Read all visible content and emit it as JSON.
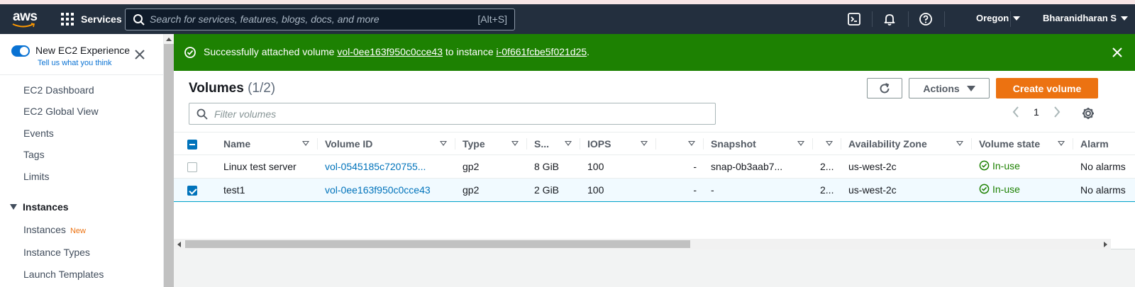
{
  "topbar": {
    "logo_text": "aws",
    "services_label": "Services",
    "search_placeholder": "Search for services, features, blogs, docs, and more",
    "search_shortcut": "[Alt+S]",
    "region": "Oregon",
    "user": "Bharanidharan S",
    "icons": [
      "cloudshell-icon",
      "bell-icon",
      "help-icon"
    ]
  },
  "sidebar": {
    "new_experience_label": "New EC2 Experience",
    "new_experience_sub": "Tell us what you think",
    "items": [
      {
        "label": "EC2 Dashboard"
      },
      {
        "label": "EC2 Global View"
      },
      {
        "label": "Events"
      },
      {
        "label": "Tags"
      },
      {
        "label": "Limits"
      }
    ],
    "section": "Instances",
    "section_items": [
      {
        "label": "Instances",
        "badge": "New"
      },
      {
        "label": "Instance Types"
      },
      {
        "label": "Launch Templates"
      }
    ]
  },
  "flash": {
    "prefix": "Successfully attached volume",
    "volume_link": "vol-0ee163f950c0cce43",
    "middle": "to instance",
    "instance_link": "i-0f661fcbe5f021d25",
    "suffix": ".",
    "color": "#1d8102"
  },
  "volumes": {
    "title": "Volumes",
    "count": "(1/2)",
    "actions_label": "Actions",
    "create_label": "Create volume",
    "filter_placeholder": "Filter volumes",
    "page": "1",
    "columns": [
      "Name",
      "Volume ID",
      "Type",
      "S...",
      "IOPS",
      "",
      "Snapshot",
      "",
      "Availability Zone",
      "Volume state",
      "Alarm"
    ],
    "rows": [
      {
        "name": "Linux test server",
        "volume_id": "vol-0545185c720755...",
        "type": "gp2",
        "size": "8 GiB",
        "iops": "100",
        "throughput": "-",
        "snapshot": "snap-0b3aab7...",
        "created": "2...",
        "az": "us-west-2c",
        "state": "In-use",
        "alarm": "No alarms",
        "selected": false
      },
      {
        "name": "test1",
        "volume_id": "vol-0ee163f950c0cce43",
        "type": "gp2",
        "size": "2 GiB",
        "iops": "100",
        "throughput": "-",
        "snapshot": "-",
        "created": "2...",
        "az": "us-west-2c",
        "state": "In-use",
        "alarm": "No alarms",
        "selected": true
      }
    ]
  },
  "colors": {
    "accent": "#ec7211",
    "link": "#0073bb",
    "topbar": "#232f3e",
    "success": "#1d8102"
  }
}
